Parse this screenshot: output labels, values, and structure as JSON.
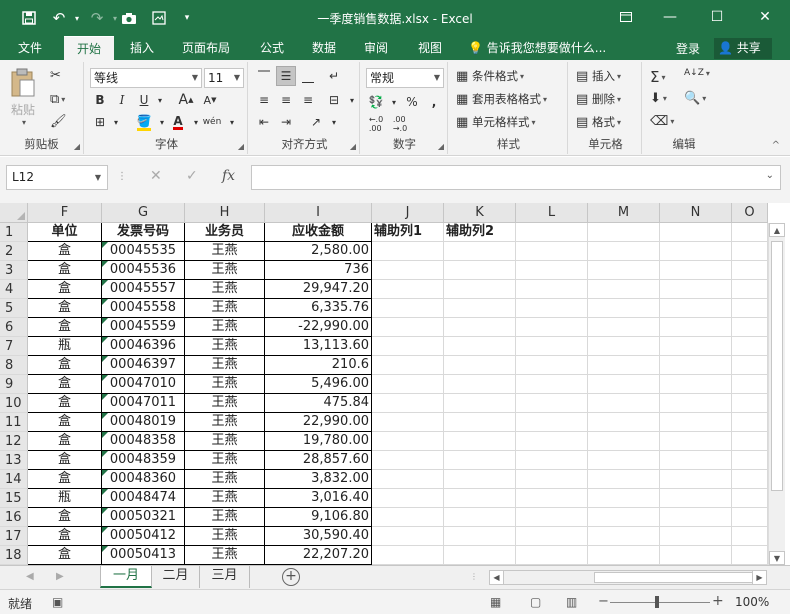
{
  "window": {
    "title": "一季度销售数据.xlsx  -  Excel"
  },
  "quick_access": {
    "save_icon": "save-icon",
    "undo_icon": "undo-icon",
    "redo_icon": "redo-icon",
    "camera_icon": "camera-icon",
    "image_icon": "insert-image-icon",
    "customize_icon": "customize-toolbar-icon"
  },
  "tabs": [
    "文件",
    "开始",
    "插入",
    "页面布局",
    "公式",
    "数据",
    "审阅",
    "视图"
  ],
  "active_tab": "开始",
  "tell_me": "告诉我您想要做什么...",
  "account": {
    "login": "登录",
    "share": "共享"
  },
  "ribbon": {
    "clipboard": {
      "label": "剪贴板",
      "paste": "粘贴"
    },
    "font": {
      "label": "字体",
      "name": "等线",
      "size": "11",
      "bold": "B",
      "italic": "I",
      "underline": "U",
      "grow": "A",
      "shrink": "A",
      "phonetic": "wén",
      "fill_letter": "A"
    },
    "alignment": {
      "label": "对齐方式"
    },
    "number": {
      "label": "数字",
      "format": "常规",
      "percent": "%",
      "comma": ","
    },
    "styles": {
      "label": "样式",
      "conditional": "条件格式",
      "table": "套用表格格式",
      "cell": "单元格样式"
    },
    "cells": {
      "label": "单元格",
      "insert": "插入",
      "delete": "删除",
      "format": "格式"
    },
    "editing": {
      "label": "编辑"
    }
  },
  "formula_bar": {
    "name_box": "L12",
    "fx": "fx",
    "value": ""
  },
  "columns": [
    "F",
    "G",
    "H",
    "I",
    "J",
    "K",
    "L",
    "M",
    "N",
    "O"
  ],
  "rows": [
    {
      "n": "1",
      "F": "单位",
      "G": "发票号码",
      "H": "业务员",
      "I": "应收金额",
      "J": "辅助列1",
      "K": "辅助列2"
    },
    {
      "n": "2",
      "F": "盒",
      "G": "00045535",
      "H": "王燕",
      "I": "2,580.00"
    },
    {
      "n": "3",
      "F": "盒",
      "G": "00045536",
      "H": "王燕",
      "I": "736"
    },
    {
      "n": "4",
      "F": "盒",
      "G": "00045557",
      "H": "王燕",
      "I": "29,947.20"
    },
    {
      "n": "5",
      "F": "盒",
      "G": "00045558",
      "H": "王燕",
      "I": "6,335.76"
    },
    {
      "n": "6",
      "F": "盒",
      "G": "00045559",
      "H": "王燕",
      "I": "-22,990.00"
    },
    {
      "n": "7",
      "F": "瓶",
      "G": "00046396",
      "H": "王燕",
      "I": "13,113.60"
    },
    {
      "n": "8",
      "F": "盒",
      "G": "00046397",
      "H": "王燕",
      "I": "210.6"
    },
    {
      "n": "9",
      "F": "盒",
      "G": "00047010",
      "H": "王燕",
      "I": "5,496.00"
    },
    {
      "n": "10",
      "F": "盒",
      "G": "00047011",
      "H": "王燕",
      "I": "475.84"
    },
    {
      "n": "11",
      "F": "盒",
      "G": "00048019",
      "H": "王燕",
      "I": "22,990.00"
    },
    {
      "n": "12",
      "F": "盒",
      "G": "00048358",
      "H": "王燕",
      "I": "19,780.00"
    },
    {
      "n": "13",
      "F": "盒",
      "G": "00048359",
      "H": "王燕",
      "I": "28,857.60"
    },
    {
      "n": "14",
      "F": "盒",
      "G": "00048360",
      "H": "王燕",
      "I": "3,832.00"
    },
    {
      "n": "15",
      "F": "瓶",
      "G": "00048474",
      "H": "王燕",
      "I": "3,016.40"
    },
    {
      "n": "16",
      "F": "盒",
      "G": "00050321",
      "H": "王燕",
      "I": "9,106.80"
    },
    {
      "n": "17",
      "F": "盒",
      "G": "00050412",
      "H": "王燕",
      "I": "30,590.40"
    },
    {
      "n": "18",
      "F": "盒",
      "G": "00050413",
      "H": "王燕",
      "I": "22,207.20"
    }
  ],
  "sheets": [
    "一月",
    "二月",
    "三月"
  ],
  "active_sheet": "一月",
  "status": {
    "text": "就绪",
    "zoom": "100%"
  },
  "colors": {
    "accent": "#217346"
  }
}
